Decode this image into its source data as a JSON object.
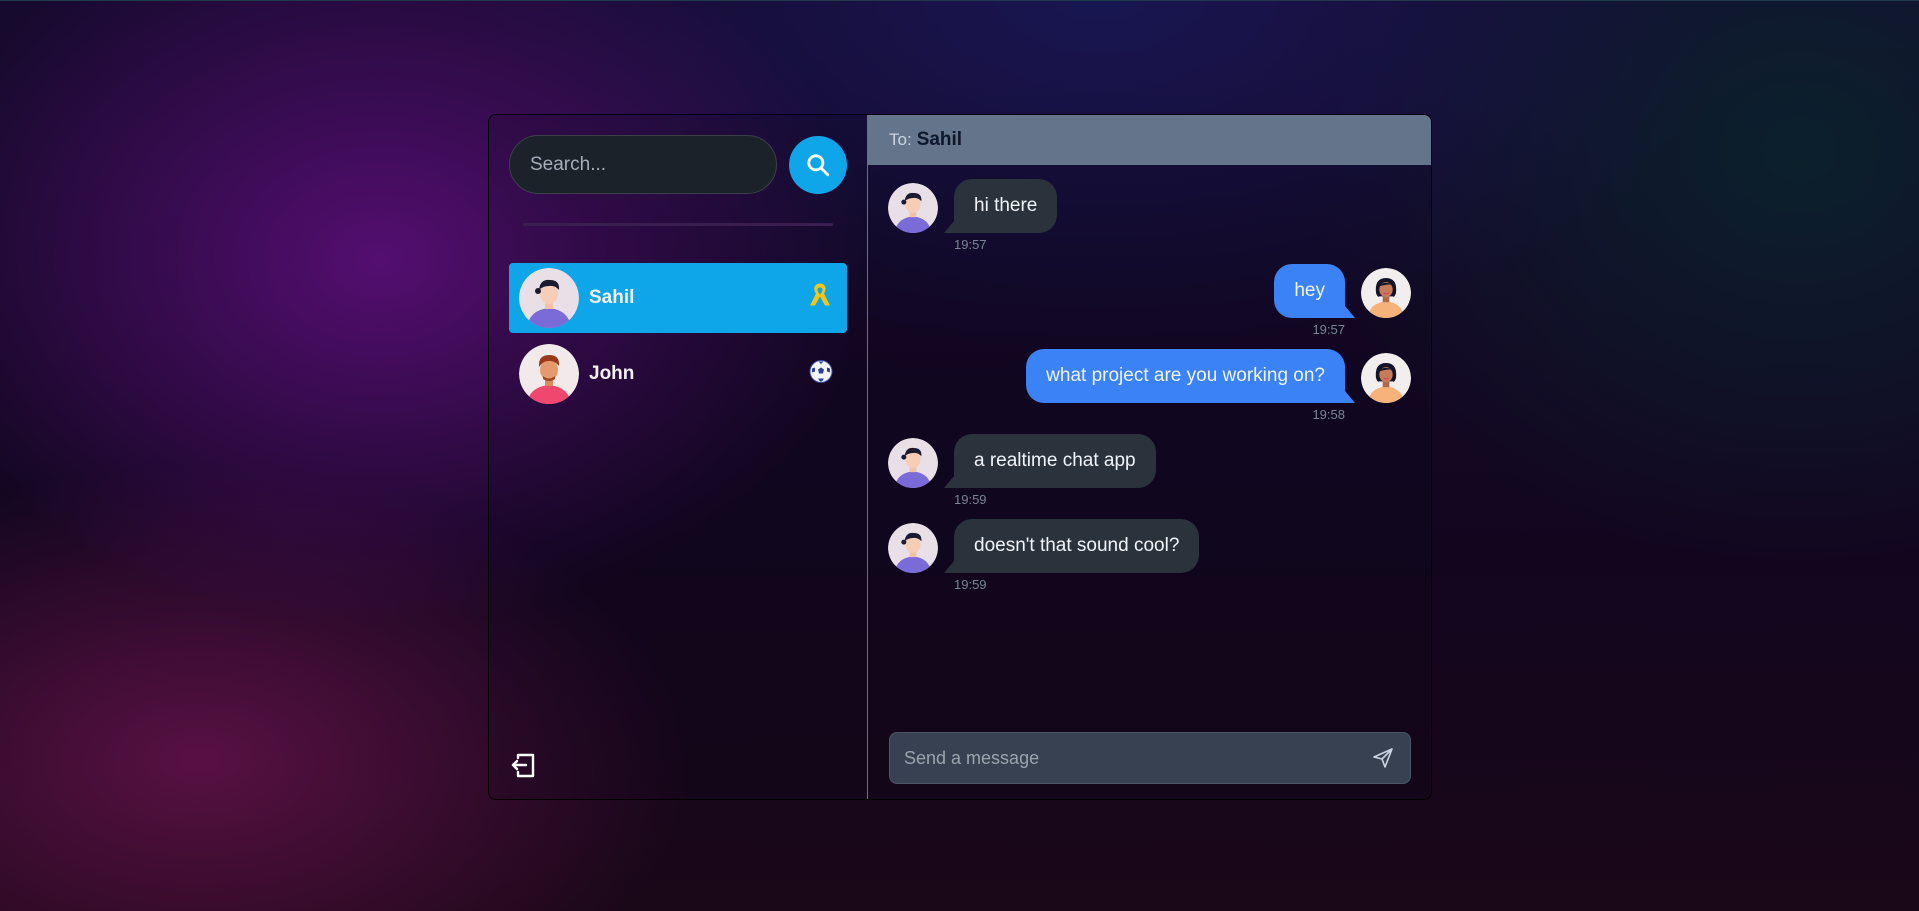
{
  "search": {
    "placeholder": "Search..."
  },
  "conversations": [
    {
      "name": "Sahil",
      "emoji": "ribbon-icon",
      "active": true
    },
    {
      "name": "John",
      "emoji": "soccer-ball-icon",
      "active": false
    }
  ],
  "header": {
    "to_label": "To:",
    "recipient": "Sahil"
  },
  "messages": [
    {
      "text": "hi there",
      "time": "19:57",
      "direction": "in"
    },
    {
      "text": "hey",
      "time": "19:57",
      "direction": "out"
    },
    {
      "text": "what project are you working on?",
      "time": "19:58",
      "direction": "out"
    },
    {
      "text": "a realtime chat app",
      "time": "19:59",
      "direction": "in"
    },
    {
      "text": "doesn't that sound cool?",
      "time": "19:59",
      "direction": "in"
    }
  ],
  "composer": {
    "placeholder": "Send a message"
  },
  "colors": {
    "accent": "#0ea5e9",
    "outgoing_bubble": "#3b82f6",
    "incoming_bubble": "#2a323c",
    "header": "#64748b"
  }
}
